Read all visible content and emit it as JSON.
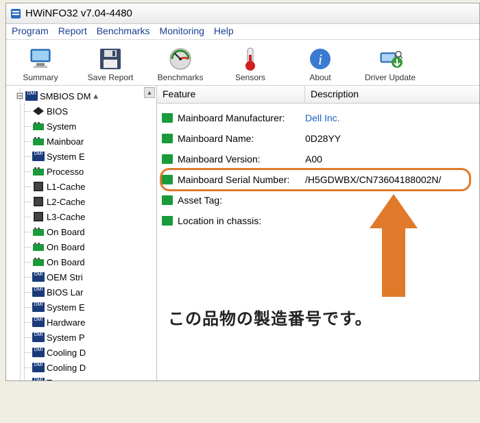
{
  "window": {
    "title": "HWiNFO32 v7.04-4480"
  },
  "menu": {
    "program": "Program",
    "report": "Report",
    "benchmarks": "Benchmarks",
    "monitoring": "Monitoring",
    "help": "Help"
  },
  "toolbar": {
    "summary": "Summary",
    "save_report": "Save Report",
    "benchmarks": "Benchmarks",
    "sensors": "Sensors",
    "about": "About",
    "driver_update": "Driver Update"
  },
  "tree": {
    "root": "SMBIOS DM",
    "items": [
      "BIOS",
      "System",
      "Mainboar",
      "System E",
      "Processo",
      "L1-Cache",
      "L2-Cache",
      "L3-Cache",
      "On Board",
      "On Board",
      "On Board",
      "OEM Stri",
      "BIOS Lar",
      "System E",
      "Hardware",
      "System P",
      "Cooling D",
      "Cooling D",
      "Tempera"
    ]
  },
  "list": {
    "header_feature": "Feature",
    "header_description": "Description",
    "rows": [
      {
        "feature": "Mainboard Manufacturer:",
        "description": "Dell Inc.",
        "link": true
      },
      {
        "feature": "Mainboard Name:",
        "description": "0D28YY"
      },
      {
        "feature": "Mainboard Version:",
        "description": "A00"
      },
      {
        "feature": "Mainboard Serial Number:",
        "description": "/H5GDWBX/CN73604188002N/"
      },
      {
        "feature": "Asset Tag:",
        "description": ""
      },
      {
        "feature": "Location in chassis:",
        "description": ""
      }
    ]
  },
  "annotation": {
    "text": "この品物の製造番号です。"
  },
  "colors": {
    "highlight": "#e07a2a",
    "link": "#1a5fc4"
  }
}
